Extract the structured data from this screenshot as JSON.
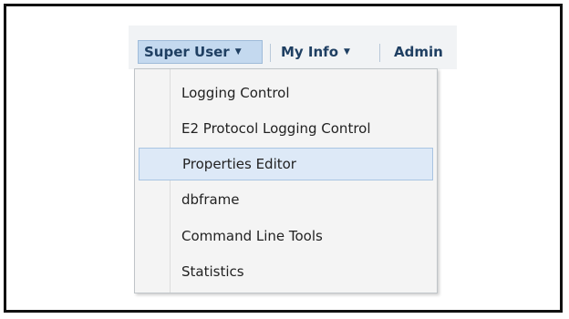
{
  "menubar": {
    "items": [
      {
        "label": "Super User",
        "caret": "▼"
      },
      {
        "label": "My Info",
        "caret": "▼"
      },
      {
        "label": "Admin"
      }
    ]
  },
  "dropdown": {
    "items": [
      {
        "label": "Logging Control"
      },
      {
        "label": "E2 Protocol Logging Control"
      },
      {
        "label": "Properties Editor",
        "highlighted": true
      },
      {
        "label": "dbframe"
      },
      {
        "label": "Command Line Tools"
      },
      {
        "label": "Statistics"
      }
    ]
  },
  "colors": {
    "menu_text": "#1f3f62",
    "active_menu_bg": "#c4d9ef",
    "highlight_bg": "#dde9f7",
    "dropdown_bg": "#f4f4f4"
  }
}
